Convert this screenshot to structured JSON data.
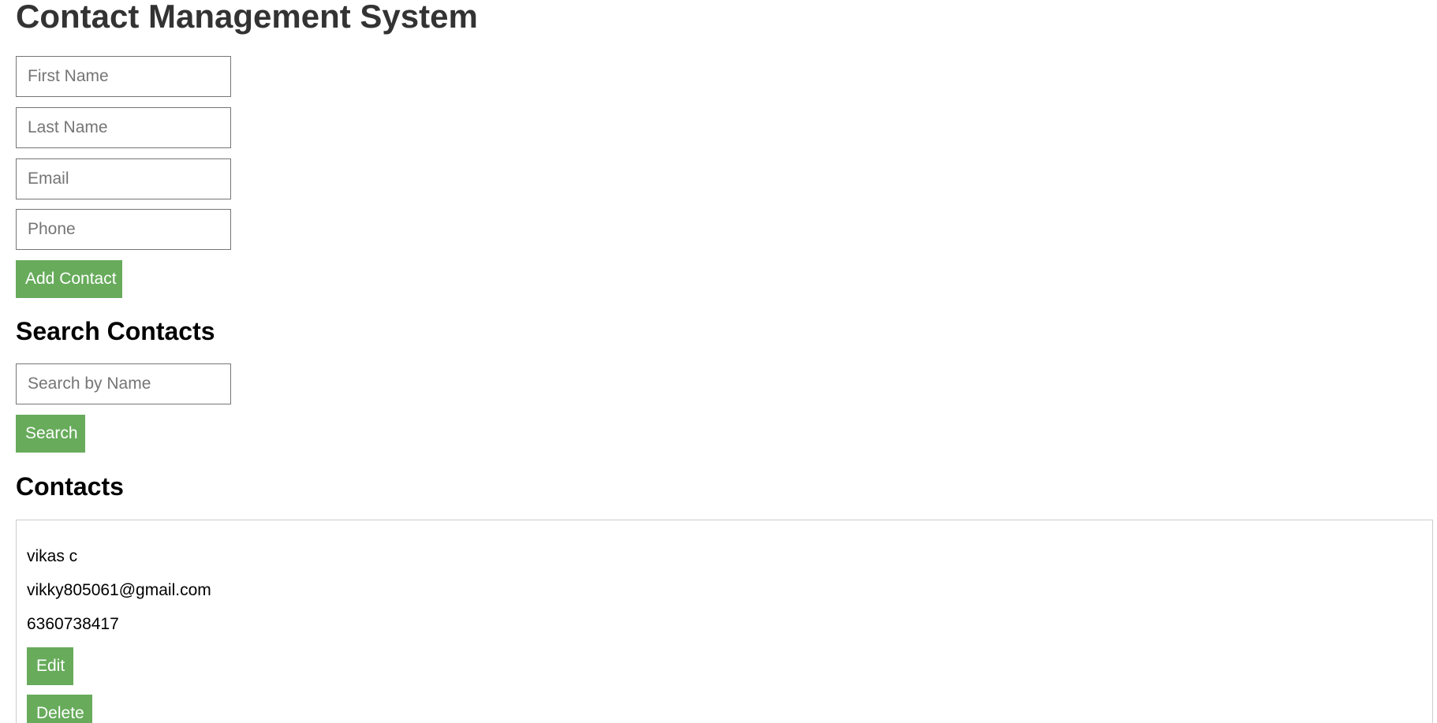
{
  "header": {
    "title": "Contact Management System"
  },
  "add_form": {
    "first_name_placeholder": "First Name",
    "last_name_placeholder": "Last Name",
    "email_placeholder": "Email",
    "phone_placeholder": "Phone",
    "submit_label": "Add Contact"
  },
  "search": {
    "heading": "Search Contacts",
    "placeholder": "Search by Name",
    "button_label": "Search"
  },
  "contacts": {
    "heading": "Contacts",
    "items": [
      {
        "name": "vikas c",
        "email": "vikky805061@gmail.com",
        "phone": "6360738417",
        "edit_label": "Edit",
        "delete_label": "Delete"
      }
    ]
  },
  "colors": {
    "button_bg": "#67ab5b",
    "button_text": "#ffffff",
    "title_text": "#333333",
    "input_border": "#767676",
    "card_border": "#cccccc"
  }
}
